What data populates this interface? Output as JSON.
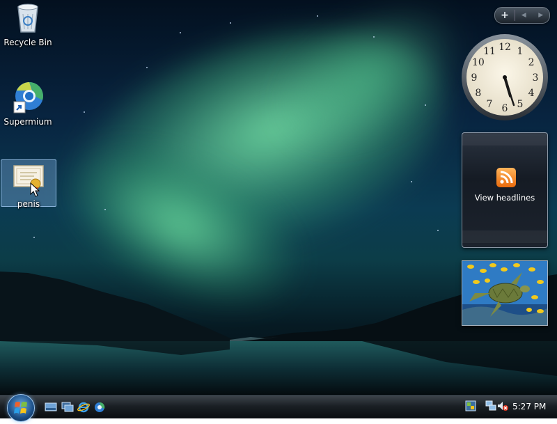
{
  "desktop": {
    "icons": [
      {
        "label": "Recycle Bin",
        "icon": "recycle-bin-icon"
      },
      {
        "label": "Supermium",
        "icon": "supermium-browser-icon"
      },
      {
        "label": "penis",
        "icon": "certificate-file-icon"
      }
    ]
  },
  "sidebar": {
    "controls": {
      "add": "+",
      "prev": "◀",
      "next": "▶"
    },
    "clock": {
      "hour": 5,
      "minute": 27,
      "numerals": [
        "12",
        "1",
        "2",
        "3",
        "4",
        "5",
        "6",
        "7",
        "8",
        "9",
        "10",
        "11"
      ]
    },
    "feed": {
      "label": "View headlines",
      "icon": "rss-icon"
    },
    "slideshow": {
      "icon": "sea-turtle-photo"
    }
  },
  "taskbar": {
    "start_icon": "windows-orb-icon",
    "quick_launch": [
      "show-desktop-icon",
      "switch-windows-icon",
      "internet-explorer-icon",
      "supermium-icon"
    ],
    "tray": [
      "windows-sidebar-icon",
      "network-icon",
      "volume-muted-icon"
    ],
    "time": "5:27 PM"
  },
  "colors": {
    "accent": "#3b7fc4",
    "rss": "#f08a24"
  }
}
